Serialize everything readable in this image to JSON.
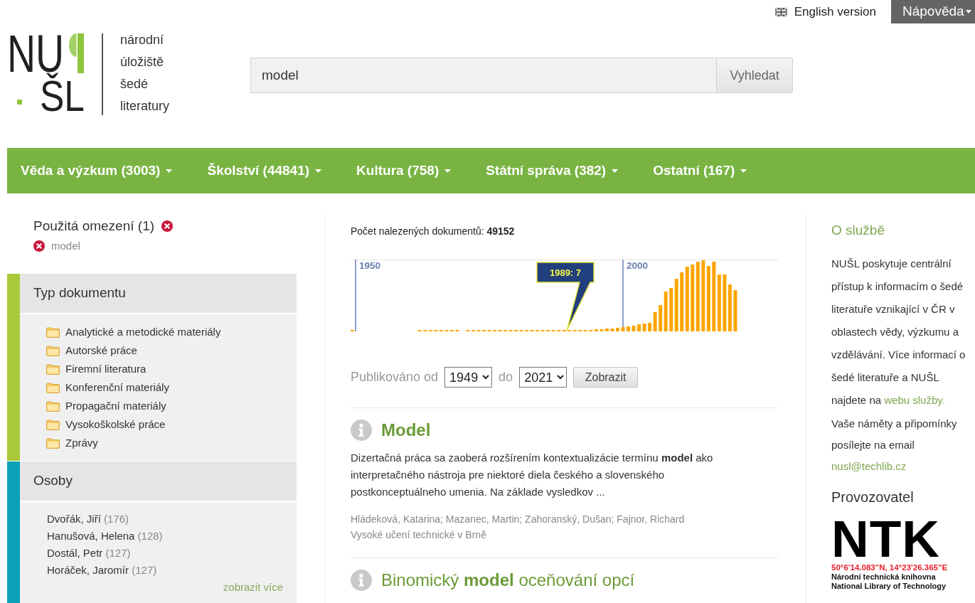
{
  "top_links": {
    "language": "English version",
    "help_menu": "Nápověda"
  },
  "logo": {
    "wordmark_top": "NU",
    "wordmark_bottom": "ŠL",
    "tagline": [
      "národní",
      "úložiště",
      "šedé",
      "literatury"
    ]
  },
  "search": {
    "value": "model",
    "button": "Vyhledat"
  },
  "categories": [
    {
      "label": "Věda a výzkum (3003)"
    },
    {
      "label": "Školství (44841)"
    },
    {
      "label": "Kultura (758)"
    },
    {
      "label": "Státní správa (382)"
    },
    {
      "label": "Ostatní (167)"
    }
  ],
  "applied_filters": {
    "title": "Použitá omezení (1)",
    "items": [
      {
        "label": "model"
      }
    ]
  },
  "facets": [
    {
      "title": "Typ dokumentu",
      "kind": "folders",
      "color": "#a9c93b",
      "items": [
        {
          "label": "Analytické a metodické materiály"
        },
        {
          "label": "Autorské práce"
        },
        {
          "label": "Firemní literatura"
        },
        {
          "label": "Konferenční materiály"
        },
        {
          "label": "Propagační materiály"
        },
        {
          "label": "Vysokoškolské práce"
        },
        {
          "label": "Zprávy"
        }
      ]
    },
    {
      "title": "Osoby",
      "kind": "people",
      "color": "#0aa1b9",
      "items": [
        {
          "name": "Dvořák, Jiří",
          "count": "(176)"
        },
        {
          "name": "Hanušová, Helena",
          "count": "(128)"
        },
        {
          "name": "Dostál, Petr",
          "count": "(127)"
        },
        {
          "name": "Horáček, Jaromír",
          "count": "(127)"
        }
      ],
      "more": "zobrazit více"
    }
  ],
  "results_summary": "Počet nalezených dokumentů: **49152**",
  "histogram": {
    "year_labels": [
      "1950",
      "2000"
    ],
    "tooltip": "1989: 7"
  },
  "date_filter": {
    "label_from": "Publikováno od",
    "from": "1949",
    "label_to": "do",
    "to": "2021",
    "button": "Zobrazit"
  },
  "results": [
    {
      "title": "Model",
      "exact_match": true,
      "abstract": "Dizertačná práca sa zaoberá rozšírením kontextualizácie termínu **model** ako interpretačného nástroja pre niektoré diela českého a slovenského postkonceptuálneho umenia. Na základe vysledkov ...",
      "authors": "Hládeková, Katarina; Mazanec, Martin; Zahoranský, Dušan; Fajnor, Richard",
      "institution": "Vysoké učení technické v Brně"
    },
    {
      "title": "Binomický **model** oceňování opcí",
      "exact_match": false
    }
  ],
  "about": {
    "title": "O službě",
    "text": "NUŠL poskytuje centrální přístup k informacím o šedé literatuře vznikající v ČR v oblastech vědy, výzkumu a vzdělávání. Více informací o šedé literatuře a NUŠL najdete na",
    "link": "webu služby.",
    "contact_text": "Vaše náměty a připomínky posílejte na email",
    "contact_link": "nusl@techlib.cz"
  },
  "operator": {
    "title": "Provozovatel",
    "logo_mark": "NTK",
    "coordinates": "50°6'14.083\"N, 14°23'26.365\"E",
    "name_cs": "Národní technická knihovna",
    "name_en": "National Library of Technology"
  }
}
